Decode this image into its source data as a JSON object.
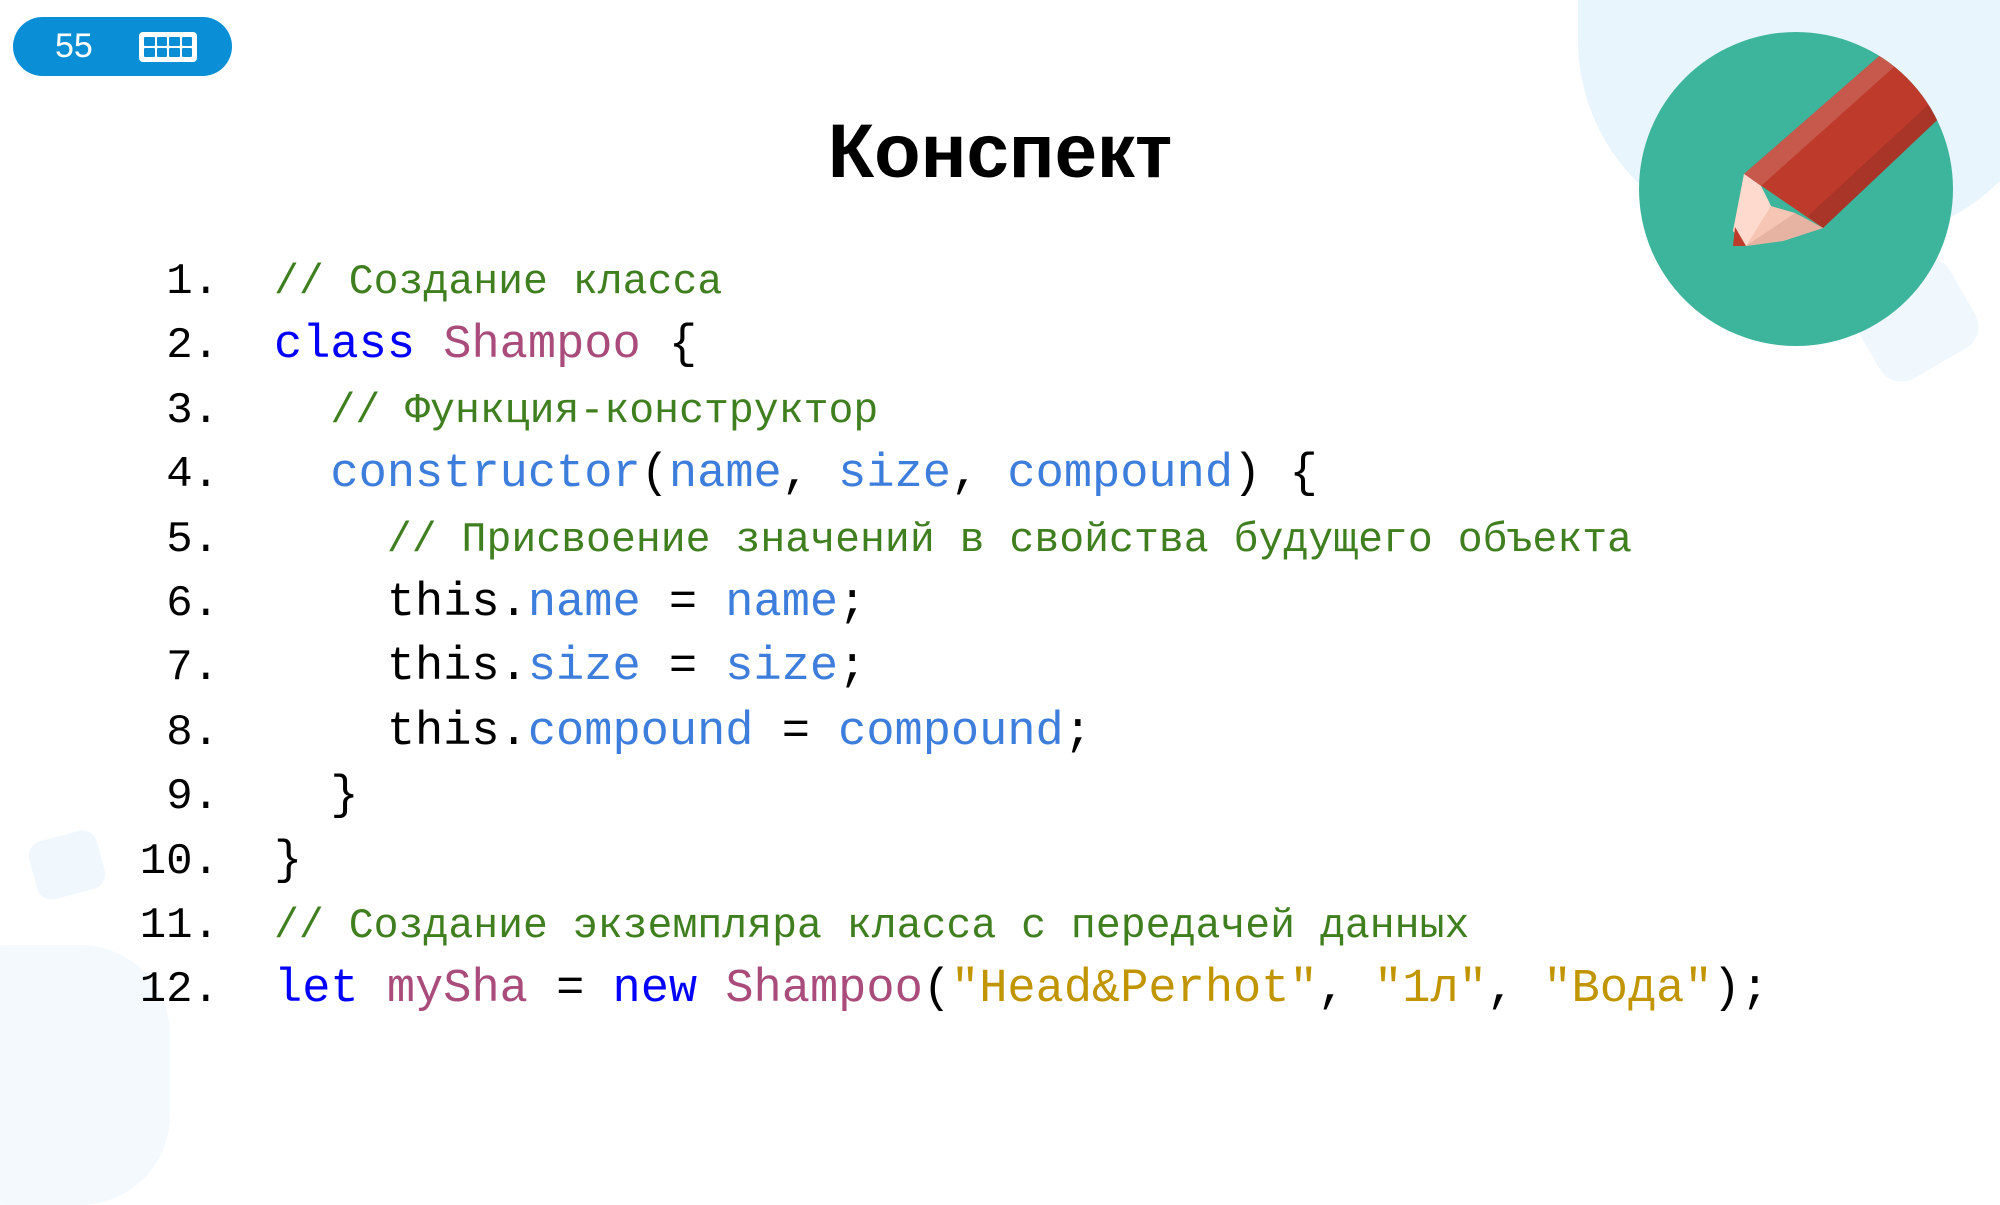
{
  "badge": {
    "slide_number": "55",
    "icon": "keyboard-icon"
  },
  "title": "Конспект",
  "illustration": {
    "icon": "pencil-icon",
    "colors": {
      "circle": "#3db49c",
      "pencil": "#be3a2b"
    }
  },
  "colors": {
    "comment": "#3f7f1f",
    "keyword": "#0000ff",
    "class": "#a94c7c",
    "identifier": "#3d7ddc",
    "string": "#c09500",
    "badge": "#0a8fd6"
  },
  "code": [
    {
      "n": "1.",
      "tokens": [
        {
          "t": "comment",
          "v": "// Создание класса"
        }
      ]
    },
    {
      "n": "2.",
      "tokens": [
        {
          "t": "kw",
          "v": "class"
        },
        {
          "t": "plain",
          "v": " "
        },
        {
          "t": "cls",
          "v": "Shampoo"
        },
        {
          "t": "plain",
          "v": " {"
        }
      ]
    },
    {
      "n": "3.",
      "tokens": [
        {
          "t": "plain",
          "v": "  "
        },
        {
          "t": "comment",
          "v": "// Функция-конструктор"
        }
      ]
    },
    {
      "n": "4.",
      "tokens": [
        {
          "t": "plain",
          "v": "  "
        },
        {
          "t": "id",
          "v": "constructor"
        },
        {
          "t": "plain",
          "v": "("
        },
        {
          "t": "id",
          "v": "name"
        },
        {
          "t": "plain",
          "v": ", "
        },
        {
          "t": "id",
          "v": "size"
        },
        {
          "t": "plain",
          "v": ", "
        },
        {
          "t": "id",
          "v": "compound"
        },
        {
          "t": "plain",
          "v": ") {"
        }
      ]
    },
    {
      "n": "5.",
      "tokens": [
        {
          "t": "plain",
          "v": "    "
        },
        {
          "t": "comment",
          "v": "// Присвоение значений в свойства будущего объекта"
        }
      ]
    },
    {
      "n": "6.",
      "tokens": [
        {
          "t": "plain",
          "v": "    this."
        },
        {
          "t": "id",
          "v": "name"
        },
        {
          "t": "plain",
          "v": " = "
        },
        {
          "t": "id",
          "v": "name"
        },
        {
          "t": "plain",
          "v": ";"
        }
      ]
    },
    {
      "n": "7.",
      "tokens": [
        {
          "t": "plain",
          "v": "    this."
        },
        {
          "t": "id",
          "v": "size"
        },
        {
          "t": "plain",
          "v": " = "
        },
        {
          "t": "id",
          "v": "size"
        },
        {
          "t": "plain",
          "v": ";"
        }
      ]
    },
    {
      "n": "8.",
      "tokens": [
        {
          "t": "plain",
          "v": "    this."
        },
        {
          "t": "id",
          "v": "compound"
        },
        {
          "t": "plain",
          "v": " = "
        },
        {
          "t": "id",
          "v": "compound"
        },
        {
          "t": "plain",
          "v": ";"
        }
      ]
    },
    {
      "n": "9.",
      "tokens": [
        {
          "t": "plain",
          "v": "  }"
        }
      ]
    },
    {
      "n": "10.",
      "tokens": [
        {
          "t": "plain",
          "v": "}"
        }
      ]
    },
    {
      "n": "11.",
      "tokens": [
        {
          "t": "comment",
          "v": "// Создание экземпляра класса с передачей данных"
        }
      ]
    },
    {
      "n": "12.",
      "tokens": [
        {
          "t": "kw",
          "v": "let"
        },
        {
          "t": "plain",
          "v": " "
        },
        {
          "t": "cls",
          "v": "mySha"
        },
        {
          "t": "plain",
          "v": " = "
        },
        {
          "t": "kw",
          "v": "new"
        },
        {
          "t": "plain",
          "v": " "
        },
        {
          "t": "cls",
          "v": "Shampoo"
        },
        {
          "t": "plain",
          "v": "("
        },
        {
          "t": "str",
          "v": "\"Head&Perhot\""
        },
        {
          "t": "plain",
          "v": ", "
        },
        {
          "t": "str",
          "v": "\"1л\""
        },
        {
          "t": "plain",
          "v": ", "
        },
        {
          "t": "str",
          "v": "\"Вода\""
        },
        {
          "t": "plain",
          "v": ");"
        }
      ]
    }
  ]
}
